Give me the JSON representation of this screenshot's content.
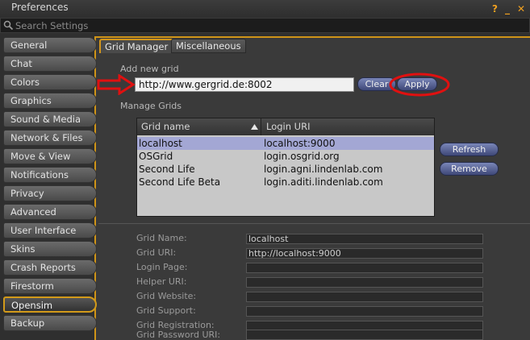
{
  "window": {
    "title": "Preferences",
    "help_label": "?",
    "minimize_label": "_",
    "close_label": "✕"
  },
  "search": {
    "placeholder": "Search Settings"
  },
  "sidebar": {
    "items": [
      {
        "label": "General"
      },
      {
        "label": "Chat"
      },
      {
        "label": "Colors"
      },
      {
        "label": "Graphics"
      },
      {
        "label": "Sound & Media"
      },
      {
        "label": "Network & Files"
      },
      {
        "label": "Move & View"
      },
      {
        "label": "Notifications"
      },
      {
        "label": "Privacy"
      },
      {
        "label": "Advanced"
      },
      {
        "label": "User Interface"
      },
      {
        "label": "Skins"
      },
      {
        "label": "Crash Reports"
      },
      {
        "label": "Firestorm"
      },
      {
        "label": "Opensim"
      },
      {
        "label": "Backup"
      }
    ],
    "selected": "Opensim"
  },
  "tabs": [
    {
      "label": "Grid Manager"
    },
    {
      "label": "Miscellaneous"
    }
  ],
  "add_grid": {
    "label": "Add new grid",
    "value": "http://www.gergrid.de:8002",
    "clear_label": "Clear",
    "apply_label": "Apply"
  },
  "manage": {
    "label": "Manage Grids",
    "columns": {
      "name": "Grid name",
      "uri": "Login URI"
    },
    "rows": [
      {
        "name": "localhost",
        "uri": "localhost:9000"
      },
      {
        "name": "OSGrid",
        "uri": "login.osgrid.org"
      },
      {
        "name": "Second Life",
        "uri": "login.agni.lindenlab.com"
      },
      {
        "name": "Second Life Beta",
        "uri": "login.aditi.lindenlab.com"
      }
    ],
    "selected_row": "localhost",
    "refresh_label": "Refresh",
    "remove_label": "Remove"
  },
  "details": {
    "fields": [
      {
        "label": "Grid Name:",
        "value": "localhost"
      },
      {
        "label": "Grid URI:",
        "value": "http://localhost:9000"
      },
      {
        "label": "Login Page:",
        "value": ""
      },
      {
        "label": "Helper URI:",
        "value": ""
      },
      {
        "label": "Grid Website:",
        "value": ""
      },
      {
        "label": "Grid Support:",
        "value": ""
      },
      {
        "label": "Grid Registration:",
        "value": ""
      },
      {
        "label": "Grid Password URI:",
        "value": ""
      }
    ]
  },
  "colors": {
    "accent": "#d29a1a",
    "annotation": "#e01010",
    "selection": "#a3a7d4"
  }
}
